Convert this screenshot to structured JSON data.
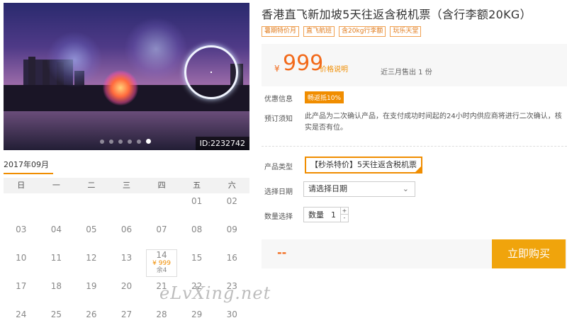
{
  "photo": {
    "id_label": "ID:2232742",
    "carousel_total": 6,
    "carousel_active": 6
  },
  "calendar": {
    "month_tab": "2017年09月",
    "weekdays": [
      "日",
      "一",
      "二",
      "三",
      "四",
      "五",
      "六"
    ],
    "weeks": [
      [
        "",
        "",
        "",
        "",
        "",
        "01",
        "02"
      ],
      [
        "03",
        "04",
        "05",
        "06",
        "07",
        "08",
        "09"
      ],
      [
        "10",
        "11",
        "12",
        "13",
        "14",
        "15",
        "16"
      ],
      [
        "17",
        "18",
        "19",
        "20",
        "21",
        "22",
        "23"
      ],
      [
        "24",
        "25",
        "26",
        "27",
        "28",
        "29",
        "30"
      ]
    ],
    "priced_day": {
      "day": "14",
      "price": "¥ 999",
      "stock": "余4"
    }
  },
  "product": {
    "title": "香港直飞新加坡5天往返含税机票（含行李额20KG）",
    "tags": [
      "暑期特价月",
      "直飞航班",
      "含20kg行李额",
      "玩乐天堂"
    ],
    "currency_symbol": "¥",
    "price": "999",
    "price_note": "价格说明",
    "sold_text": "近三月售出 1 份",
    "promo_label": "优惠信息",
    "promo_badge": "畅返抵10%",
    "notice_label": "预订须知",
    "notice_text": "此产品为二次确认产品，在支付成功时间起的24小时内供应商将进行二次确认，核实是否有位。",
    "type_label": "产品类型",
    "type_option": "【秒杀特价】5天往返含税机票",
    "date_label": "选择日期",
    "date_placeholder": "请选择日期",
    "qty_label": "数量选择",
    "qty_field_label": "数量",
    "qty_value": "1",
    "qty_plus": "+",
    "qty_minus": "-",
    "total": "--",
    "buy_button": "立即购买"
  },
  "watermark": "eLvXing.net",
  "colors": {
    "accent": "#f08d00",
    "price": "#f26a1b",
    "buy": "#f0a40c"
  }
}
